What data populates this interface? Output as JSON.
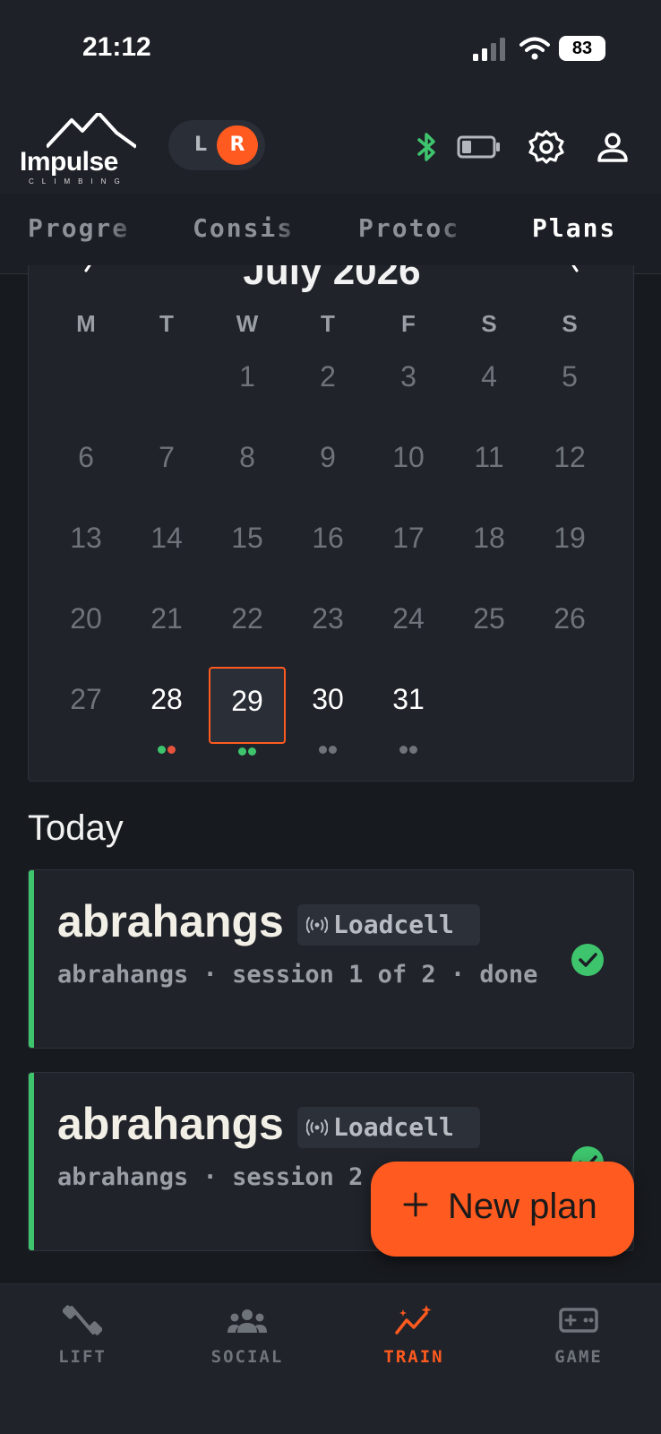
{
  "status_bar": {
    "time": "21:12",
    "battery": "83"
  },
  "header": {
    "logo_text": "Impulse",
    "logo_sub": "CLIMBING",
    "hand_left": "L",
    "hand_right": "R",
    "icons": [
      "bluetooth-icon",
      "device-battery-icon",
      "gear-icon",
      "profile-icon"
    ],
    "accent_color": "#ff5a1f",
    "bluetooth_color": "#3ec46d"
  },
  "tabs": [
    {
      "label": "Progre"
    },
    {
      "label": "Consis"
    },
    {
      "label": "Protoc"
    },
    {
      "label": "Plans",
      "active": true
    }
  ],
  "calendar": {
    "month": "July 2026",
    "weekdays": [
      "M",
      "T",
      "W",
      "T",
      "F",
      "S",
      "S"
    ],
    "days": [
      "1",
      "2",
      "3",
      "4",
      "5",
      "6",
      "7",
      "8",
      "9",
      "10",
      "11",
      "12",
      "13",
      "14",
      "15",
      "16",
      "17",
      "18",
      "19",
      "20",
      "21",
      "22",
      "23",
      "24",
      "25",
      "26",
      "27",
      "28",
      "29",
      "30",
      "31"
    ],
    "first_weekday_index": 2,
    "selected_day": "29",
    "day_markers": {
      "28": [
        "#3ec46d",
        "#e5533c"
      ],
      "29": [
        "#3ec46d",
        "#3ec46d"
      ],
      "30": [
        "#6f737a",
        "#6f737a"
      ],
      "31": [
        "#6f737a",
        "#6f737a"
      ]
    }
  },
  "today": {
    "heading": "Today",
    "sessions": [
      {
        "title": "abrahangs",
        "badge": "Loadcell",
        "subtitle": "abrahangs · session 1 of 2 · done",
        "status": "done"
      },
      {
        "title": "abrahangs",
        "badge": "Loadcell",
        "subtitle": "abrahangs · session 2 of 2 · done",
        "status": "done"
      }
    ]
  },
  "fab": {
    "label": "New plan"
  },
  "bottom_nav": [
    {
      "label": "LIFT",
      "icon": "dumbbell-icon"
    },
    {
      "label": "SOCIAL",
      "icon": "group-icon"
    },
    {
      "label": "TRAIN",
      "icon": "trend-icon",
      "active": true
    },
    {
      "label": "GAME",
      "icon": "gamepad-icon"
    }
  ]
}
